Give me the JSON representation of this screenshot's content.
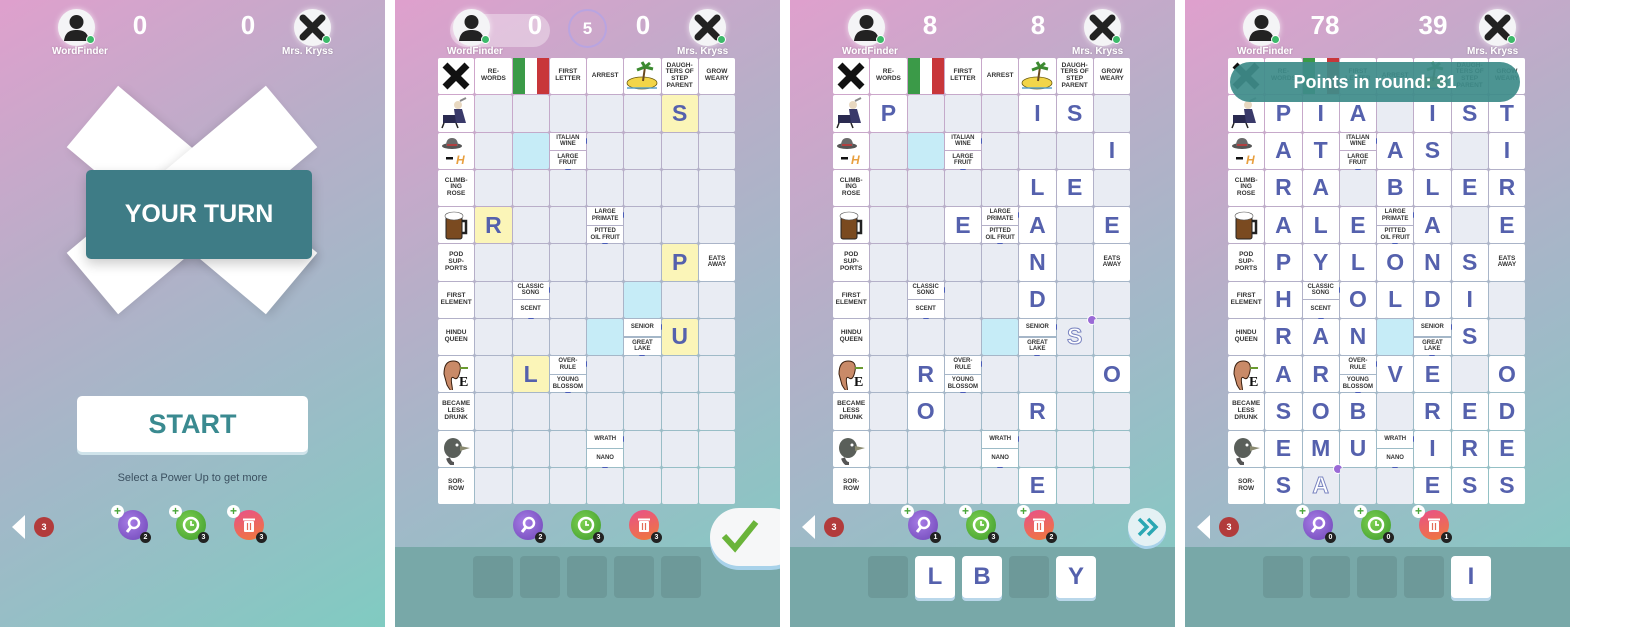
{
  "players": {
    "left": "WordFinder",
    "right": "Mrs. Kryss"
  },
  "colors": {
    "accent_teal": "#3e7c86",
    "letter_blue": "#5561ad",
    "placed_yellow": "#fbf5b8",
    "highlight_blue": "#c6ecf7",
    "tray": "#78a8a8",
    "online_dot": "#3cb96a"
  },
  "intro": {
    "scores": [
      "0",
      "0"
    ],
    "title": "YOUR TURN",
    "start": "START",
    "hint": "Select a Power Up to get more",
    "back_badge": "3",
    "powerups": [
      {
        "icon": "magnifier-icon",
        "count": "2"
      },
      {
        "icon": "clock-icon",
        "count": "3"
      },
      {
        "icon": "trash-icon",
        "count": "3"
      }
    ]
  },
  "board": {
    "header": [
      {
        "image": "x-icon"
      },
      {
        "text": "RE-\nWORDS"
      },
      {
        "image": "italian-flag"
      },
      {
        "text": "FIRST\nLETTER"
      },
      {
        "text": "ARREST"
      },
      {
        "image": "island"
      },
      {
        "text": "DAUGH-\nTERS OF\nSTEP\nPARENT"
      },
      {
        "text": "GROW\nWEARY"
      }
    ],
    "left": [
      {
        "image": "pianist"
      },
      {
        "image": "hat-minus-h"
      },
      {
        "text": "CLIMB-\nING\nROSE"
      },
      {
        "image": "beer-mug"
      },
      {
        "text": "POD\nSUP-\nPORTS"
      },
      {
        "text": "FIRST\nELEMENT"
      },
      {
        "text": "HINDU\nQUEEN"
      },
      {
        "image": "ear-e"
      },
      {
        "text": "BECAME\nLESS\nDRUNK"
      },
      {
        "image": "emu"
      },
      {
        "text": "SOR-\nROW"
      }
    ],
    "inner_clues": [
      {
        "row": 2,
        "col": 3,
        "lines": [
          "ITALIAN\nWINE",
          "LARGE\nFRUIT"
        ]
      },
      {
        "row": 4,
        "col": 4,
        "lines": [
          "LARGE\nPRIMATE",
          "PITTED\nOIL FRUIT"
        ]
      },
      {
        "row": 5,
        "col": 7,
        "lines": [
          "EATS\nAWAY"
        ]
      },
      {
        "row": 6,
        "col": 2,
        "lines": [
          "CLASSIC\nSONG",
          "SCENT"
        ]
      },
      {
        "row": 7,
        "col": 5,
        "lines": [
          "SENIOR",
          "GREAT\nLAKE"
        ]
      },
      {
        "row": 8,
        "col": 3,
        "lines": [
          "OVER-\nRULE",
          "YOUNG\nBLOSSOM"
        ]
      },
      {
        "row": 10,
        "col": 4,
        "lines": [
          "WRATH",
          "NANO"
        ]
      }
    ],
    "highlight_cells": [
      [
        2,
        2
      ],
      [
        6,
        5
      ],
      [
        7,
        4
      ]
    ]
  },
  "screens": [
    {
      "scores": [
        "0",
        "0"
      ],
      "timer": "5",
      "letter_style": "yellow",
      "back_badge": "",
      "rows": [
        ".....S.",
        "..#....",
        ".......",
        "R..#...",
        ".....P#",
        ".#.....",
        "....#U.",
        ".L#....",
        ".......",
        "...#...",
        "......."
      ],
      "powerups": [
        {
          "icon": "magnifier-icon",
          "count": "2",
          "plus": false
        },
        {
          "icon": "clock-icon",
          "count": "3",
          "plus": false
        },
        {
          "icon": "trash-icon",
          "count": "3",
          "plus": false
        }
      ],
      "tray": [
        "",
        "",
        "",
        "",
        ""
      ],
      "action": "check-icon"
    },
    {
      "scores": [
        "8",
        "8"
      ],
      "letter_style": "white",
      "back_badge": "3",
      "rows": [
        "P...IS.",
        "..#...I",
        "....LE.",
        "..E#A.E",
        "....N.#",
        ".#..D..",
        "....#s.",
        ".R#...O",
        ".O..R..",
        "...#...",
        "....E.."
      ],
      "powerups": [
        {
          "icon": "magnifier-icon",
          "count": "1",
          "plus": true
        },
        {
          "icon": "clock-icon",
          "count": "3",
          "plus": true
        },
        {
          "icon": "trash-icon",
          "count": "2",
          "plus": true
        }
      ],
      "tray": [
        "",
        "L",
        "B",
        "",
        "Y"
      ],
      "action": "fast-forward-icon"
    },
    {
      "scores": [
        "78",
        "39"
      ],
      "letter_style": "white",
      "back_badge": "3",
      "toast": "Points in round: 31",
      "rows": [
        "PIA.IST",
        "AT#AS.I",
        "RA.BLER",
        "ALE#A.E",
        "PYLONS#",
        "H#OLDI.",
        "RAN.#S.",
        "AR#VE.O",
        "SOB.RED",
        "EMU#IRE",
        "Sa..ESS"
      ],
      "powerups": [
        {
          "icon": "magnifier-icon",
          "count": "0",
          "plus": true
        },
        {
          "icon": "clock-icon",
          "count": "0",
          "plus": true
        },
        {
          "icon": "trash-icon",
          "count": "1",
          "plus": true
        }
      ],
      "tray": [
        "",
        "",
        "",
        "",
        "I"
      ],
      "action": ""
    }
  ]
}
